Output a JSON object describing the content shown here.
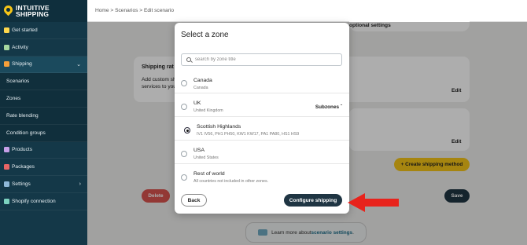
{
  "brand": {
    "line1": "INTUITIVE",
    "line2": "SHIPPING"
  },
  "sidebar": {
    "items": [
      {
        "label": "Get started",
        "icon": "rocket-icon",
        "color": "#ffd84d"
      },
      {
        "label": "Activity",
        "icon": "activity-icon",
        "color": "#a7d9a0"
      },
      {
        "label": "Shipping",
        "icon": "truck-icon",
        "color": "#f59f3a"
      },
      {
        "label": "Scenarios"
      },
      {
        "label": "Zones"
      },
      {
        "label": "Rate blending"
      },
      {
        "label": "Condition groups"
      },
      {
        "label": "Products",
        "icon": "box-icon",
        "color": "#c7a0e8"
      },
      {
        "label": "Packages",
        "icon": "package-icon",
        "color": "#e86565"
      },
      {
        "label": "Settings",
        "icon": "gear-icon",
        "color": "#8fb8d8"
      },
      {
        "label": "Shopify connection",
        "icon": "link-icon",
        "color": "#7dd3c0"
      }
    ]
  },
  "breadcrumb": "Home > Scenarios > Edit scenario",
  "background": {
    "optional_settings": "optional settings",
    "shipping_rates_title": "Shipping rat",
    "shipping_rates_desc_1": "Add custom sh",
    "shipping_rates_desc_2": "services to you",
    "edit_1": "Edit",
    "edit_2": "Edit",
    "create_method": "+ Create shipping method",
    "delete": "Delete",
    "save": "Save",
    "learn_more_prefix": "Learn more about ",
    "learn_more_link": "scenario settings",
    "learn_more_suffix": "."
  },
  "modal": {
    "title": "Select a zone",
    "search_placeholder": "search by zone title",
    "zones": [
      {
        "name": "Canada",
        "sub": "Canada",
        "selected": false
      },
      {
        "name": "UK",
        "sub": "United Kingdom",
        "selected": false,
        "toggle": "Subzones"
      },
      {
        "name": "Scottish Highlands",
        "sub": "IV1 IV56, PH1 PH50, KW1 KW17, PA1 PA80, HS1 HS9",
        "selected": true
      },
      {
        "name": "USA",
        "sub": "United States",
        "selected": false
      },
      {
        "name": "Rest of world",
        "sub": "All countries not included in other zones.",
        "selected": false
      }
    ],
    "back": "Back",
    "configure": "Configure shipping"
  },
  "colors": {
    "sidebar": "#143848",
    "accent_yellow": "#f5c518",
    "dark_button": "#1f3543",
    "delete": "#d9534f",
    "arrow": "#e8231c"
  }
}
